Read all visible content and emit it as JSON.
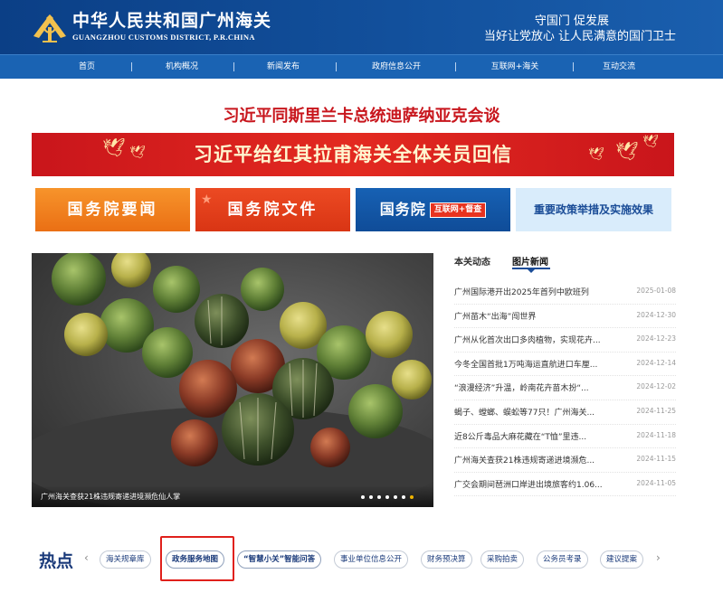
{
  "header": {
    "title": "中华人民共和国广州海关",
    "subtitle": "GUANGZHOU CUSTOMS DISTRICT, P.R.CHINA",
    "slogan_line1": "守国门 促发展",
    "slogan_line2": "当好让党放心 让人民满意的国门卫士"
  },
  "nav": {
    "items": [
      {
        "label": "首页"
      },
      {
        "label": "机构概况"
      },
      {
        "label": "新闻发布"
      },
      {
        "label": "政府信息公开"
      },
      {
        "label": "互联网+海关"
      },
      {
        "label": "互动交流"
      }
    ]
  },
  "headline": "习近平同斯里兰卡总统迪萨纳亚克会谈",
  "banner": {
    "text": "习近平给红其拉甫海关全体关员回信"
  },
  "tiles": {
    "tile1": "国务院要闻",
    "tile2": "国务院文件",
    "tile3_main": "国务院",
    "tile3_badge": "互联网+督查",
    "tile4": "重要政策举措及实施效果"
  },
  "carousel": {
    "caption": "广州海关查获21株违规寄递进境濒危仙人掌",
    "dot_count": 7,
    "active_index": 6
  },
  "news": {
    "tabs": [
      {
        "label": "本关动态"
      },
      {
        "label": "图片新闻"
      }
    ],
    "active_tab": 1,
    "items": [
      {
        "title": "广州国际港开出2025年首列中欧班列",
        "date": "2025-01-08"
      },
      {
        "title": "广州苗木“出海”闯世界",
        "date": "2024-12-30"
      },
      {
        "title": "广州从化首次出口多肉植物，实现花卉...",
        "date": "2024-12-23"
      },
      {
        "title": "今冬全国首批1万吨海运直航进口车厘...",
        "date": "2024-12-14"
      },
      {
        "title": "“浪漫经济”升温，岭南花卉苗木扮“...",
        "date": "2024-12-02"
      },
      {
        "title": "蝎子、螳螂、蜈蚣等77只！广州海关...",
        "date": "2024-11-25"
      },
      {
        "title": "近8公斤毒品大麻花藏在“T恤”里违...",
        "date": "2024-11-18"
      },
      {
        "title": "广州海关查获21株违规寄递进境濒危...",
        "date": "2024-11-15"
      },
      {
        "title": "广交会期间琶洲口岸进出境旅客约1.06...",
        "date": "2024-11-05"
      }
    ]
  },
  "hotspot": {
    "label": "热点",
    "prev": "‹",
    "next": "›",
    "pills": [
      {
        "label": "海关规章库"
      },
      {
        "label": "政务服务地图"
      },
      {
        "label": "“智慧小关”智能问答"
      },
      {
        "label": "事业单位信息公开"
      },
      {
        "label": "财务预决算"
      },
      {
        "label": "采购拍卖"
      },
      {
        "label": "公务员考录"
      },
      {
        "label": "建议提案"
      }
    ]
  },
  "colors": {
    "header_blue": "#0b3f86",
    "nav_blue": "#1a63b3",
    "headline_red": "#c8161d",
    "highlight_red": "#e0201b"
  }
}
